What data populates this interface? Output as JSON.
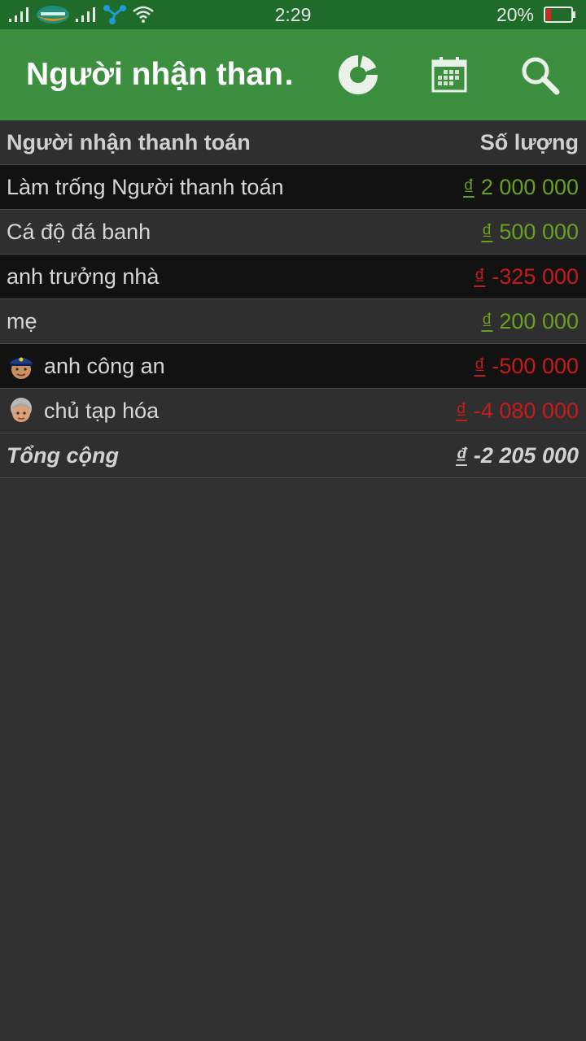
{
  "status_bar": {
    "time": "2:29",
    "battery_percent": "20%",
    "battery_level": 0.2
  },
  "app_bar": {
    "title": "Người nhận than…",
    "actions": [
      {
        "icon": "donut-chart-icon"
      },
      {
        "icon": "calendar-icon"
      },
      {
        "icon": "search-icon"
      }
    ]
  },
  "table": {
    "headers": {
      "name": "Người nhận thanh toán",
      "amount": "Số lượng"
    },
    "currency": "₫",
    "rows": [
      {
        "name": "Làm trống Người thanh toán",
        "amount": "2 000 000",
        "sign": "positive"
      },
      {
        "name": "Cá độ đá banh",
        "amount": "500 000",
        "sign": "positive"
      },
      {
        "name": "anh trưởng nhà",
        "amount": "-325 000",
        "sign": "negative"
      },
      {
        "name": "mẹ",
        "amount": "200 000",
        "sign": "positive"
      },
      {
        "name": "anh công an",
        "amount": "-500 000",
        "sign": "negative",
        "icon": "police-officer-icon"
      },
      {
        "name": "chủ tạp hóa",
        "amount": "-4 080 000",
        "sign": "negative",
        "icon": "old-woman-icon"
      }
    ],
    "total": {
      "label": "Tổng cộng",
      "amount": "-2 205 000"
    }
  },
  "colors": {
    "app_bar": "#3b8f3e",
    "status_bar": "#1f6b2a",
    "positive": "#6aa01f",
    "negative": "#c81a1a"
  }
}
